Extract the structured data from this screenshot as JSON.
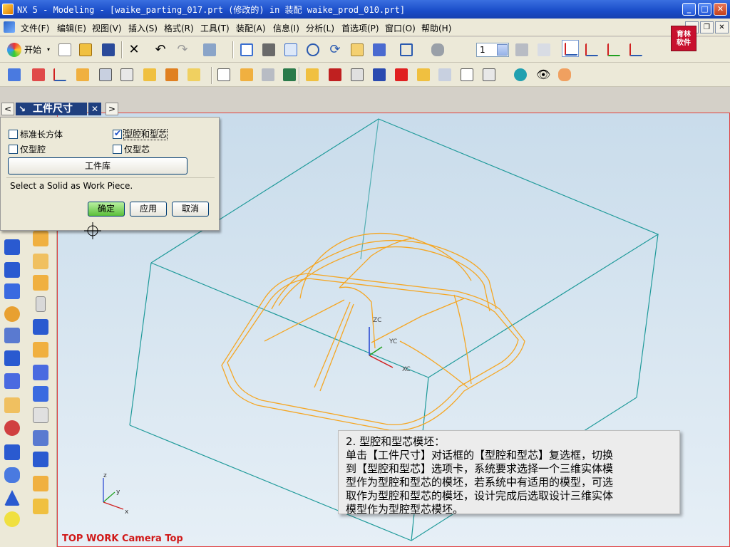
{
  "window": {
    "title": "NX 5 - Modeling - [waike_parting_017.prt  (修改的)   in 装配 waike_prod_010.prt]",
    "minimize": "_",
    "maximize": "□",
    "close": "✕"
  },
  "menu": {
    "items": [
      "文件(F)",
      "编辑(E)",
      "视图(V)",
      "插入(S)",
      "格式(R)",
      "工具(T)",
      "装配(A)",
      "信息(I)",
      "分析(L)",
      "首选项(P)",
      "窗口(O)",
      "帮助(H)"
    ],
    "doc_min": "_",
    "doc_restore": "❐",
    "doc_close": "✕"
  },
  "brand": {
    "line1": "育林",
    "line2": "软件"
  },
  "toolbar": {
    "start_label": "开始",
    "layer_value": "1"
  },
  "tab": {
    "left_arrow": "<",
    "right_arrow": ">",
    "title": "工件尺寸",
    "close": "✕"
  },
  "dialog": {
    "opt_standard_block": "标准长方体",
    "opt_cavity_core": "型腔和型芯",
    "opt_cavity_only": "仅型腔",
    "opt_core_only": "仅型芯",
    "cavity_core_checked": true,
    "library_button": "工件库",
    "hint": "Select a Solid as Work Piece.",
    "ok": "确定",
    "apply": "应用",
    "cancel": "取消"
  },
  "viewport": {
    "view_label": "TOP WORK Camera Top",
    "wcs": {
      "z": "ZC",
      "y": "YC",
      "x": "XC"
    },
    "abs": {
      "z": "z",
      "y": "y",
      "x": "x"
    },
    "colors": {
      "box": "#1f9a9a",
      "part": "#f5a623",
      "xc": "#d02020",
      "yc": "#20a020",
      "zc": "#2040d0",
      "label": "#d01818"
    }
  },
  "note": {
    "lines": [
      "2. 型腔和型芯模坯：",
      "单击【工件尺寸】对话框的【型腔和型芯】复选框，切换",
      "到【型腔和型芯】选项卡，系统要求选择一个三维实体模",
      "型作为型腔和型芯的模坯，若系统中有适用的模型，可选",
      "取作为型腔和型芯的模坯，设计完成后选取设计三维实体",
      "模型作为型腔型芯模坯。"
    ]
  }
}
